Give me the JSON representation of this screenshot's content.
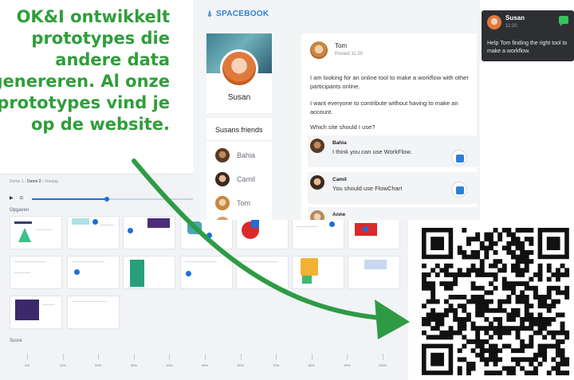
{
  "headline": {
    "lines": [
      "OK&I ontwikkelt",
      "prototypes die",
      "andere data",
      "genereren. Al onze",
      "prototypes vind je",
      "op de website."
    ]
  },
  "dashboard": {
    "breadcrumb": [
      "Demo 1",
      "Demo 2",
      "Voedag"
    ],
    "section_tasks": "Opgaven",
    "section_score": "Score",
    "progress": 0.2,
    "score_ticks": [
      "0%",
      "10%",
      "20%",
      "30%",
      "40%",
      "50%",
      "60%",
      "70%",
      "80%",
      "90%",
      "100%"
    ]
  },
  "spacebook": {
    "logo": "SPACEBOOK",
    "profile_name": "Susan",
    "friends_title": "Susans friends",
    "friends": [
      "Bahia",
      "Camil",
      "Tom"
    ],
    "post": {
      "author": "Tom",
      "time": "Posted 11:20",
      "paragraphs": [
        "I am looking for an online tool to make a workflow with other participants online.",
        "I want everyone to contribute without having to make an account.",
        "Which site should I use?"
      ],
      "comments": [
        {
          "name": "Bahia",
          "text": "I think you can use WorkFlow."
        },
        {
          "name": "Camil",
          "text": "You should use FlowChart"
        },
        {
          "name": "Anne",
          "text": ""
        }
      ]
    }
  },
  "tooltip": {
    "name": "Susan",
    "time": "11:20",
    "message": "Help Tom finding the right tool to make a workflow."
  },
  "colors": {
    "headline_green": "#2f9e3a",
    "arrow_green": "#2e9b44",
    "accent_blue": "#2f7fd6",
    "tooltip_bg": "#2d2f33",
    "chat_green": "#35c45c"
  }
}
